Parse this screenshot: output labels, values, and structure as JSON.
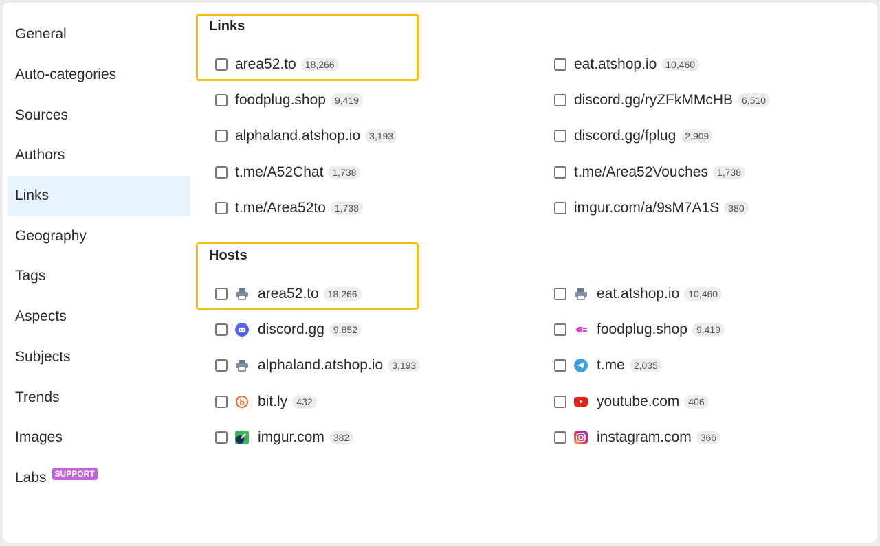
{
  "sidebar": {
    "items": [
      {
        "label": "General"
      },
      {
        "label": "Auto-categories"
      },
      {
        "label": "Sources"
      },
      {
        "label": "Authors"
      },
      {
        "label": "Links",
        "active": true
      },
      {
        "label": "Geography"
      },
      {
        "label": "Tags"
      },
      {
        "label": "Aspects"
      },
      {
        "label": "Subjects"
      },
      {
        "label": "Trends"
      },
      {
        "label": "Images"
      },
      {
        "label": "Labs",
        "badge": "SUPPORT"
      }
    ]
  },
  "links": {
    "title": "Links",
    "items": [
      {
        "label": "area52.to",
        "count": "18,266"
      },
      {
        "label": "eat.atshop.io",
        "count": "10,460"
      },
      {
        "label": "foodplug.shop",
        "count": "9,419"
      },
      {
        "label": "discord.gg/ryZFkMMcHB",
        "count": "6,510"
      },
      {
        "label": "alphaland.atshop.io",
        "count": "3,193"
      },
      {
        "label": "discord.gg/fplug",
        "count": "2,909"
      },
      {
        "label": "t.me/A52Chat",
        "count": "1,738"
      },
      {
        "label": "t.me/Area52Vouches",
        "count": "1,738"
      },
      {
        "label": "t.me/Area52to",
        "count": "1,738"
      },
      {
        "label": "imgur.com/a/9sM7A1S",
        "count": "380"
      }
    ]
  },
  "hosts": {
    "title": "Hosts",
    "items": [
      {
        "label": "area52.to",
        "count": "18,266",
        "icon": "printer"
      },
      {
        "label": "eat.atshop.io",
        "count": "10,460",
        "icon": "printer"
      },
      {
        "label": "discord.gg",
        "count": "9,852",
        "icon": "discord"
      },
      {
        "label": "foodplug.shop",
        "count": "9,419",
        "icon": "plug"
      },
      {
        "label": "alphaland.atshop.io",
        "count": "3,193",
        "icon": "printer"
      },
      {
        "label": "t.me",
        "count": "2,035",
        "icon": "telegram"
      },
      {
        "label": "bit.ly",
        "count": "432",
        "icon": "bitly"
      },
      {
        "label": "youtube.com",
        "count": "406",
        "icon": "youtube"
      },
      {
        "label": "imgur.com",
        "count": "382",
        "icon": "imgur"
      },
      {
        "label": "instagram.com",
        "count": "366",
        "icon": "instagram"
      }
    ]
  },
  "colors": {
    "highlight": "#fbbf0a",
    "active_bg": "#e8f3fd",
    "support_badge": "#c264d9"
  }
}
